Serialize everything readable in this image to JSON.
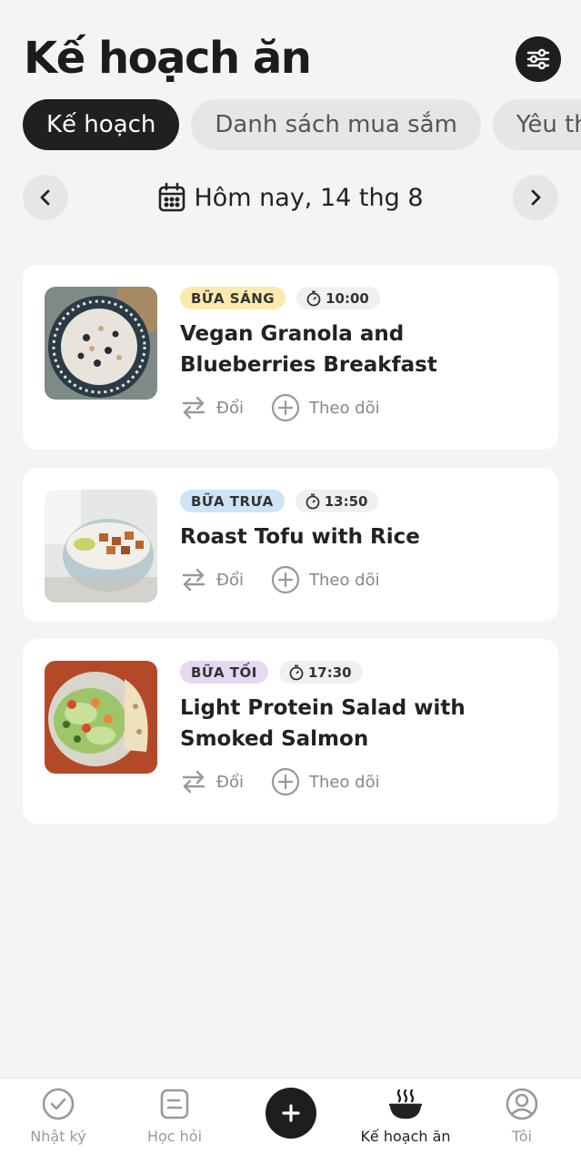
{
  "header": {
    "title": "Kế hoạch ăn",
    "settings_icon": "sliders-icon"
  },
  "tabs": [
    {
      "label": "Kế hoạch"
    },
    {
      "label": "Danh sách mua sắm"
    },
    {
      "label": "Yêu thích"
    }
  ],
  "date_nav": {
    "label": "Hôm nay, 14 thg 8"
  },
  "meals": [
    {
      "badge": "BỮA SÁNG",
      "badge_color": "#fbe9b0",
      "time": "10:00",
      "title": "Vegan Granola and Blueberries Breakfast",
      "swap": "Đổi",
      "track": "Theo dõi"
    },
    {
      "badge": "BỮA TRƯA",
      "badge_color": "#cfe3f7",
      "time": "13:50",
      "title": "Roast Tofu with Rice",
      "swap": "Đổi",
      "track": "Theo dõi"
    },
    {
      "badge": "BỮA TỐI",
      "badge_color": "#e6d8ef",
      "time": "17:30",
      "title": "Light Protein Salad with Smoked Salmon",
      "swap": "Đổi",
      "track": "Theo dõi"
    }
  ],
  "bottom_nav": [
    {
      "label": "Nhật ký",
      "icon": "check-circle-icon"
    },
    {
      "label": "Học hỏi",
      "icon": "note-icon"
    },
    {
      "label": "",
      "icon": "plus-icon"
    },
    {
      "label": "Kế hoạch ăn",
      "icon": "bowl-icon",
      "active": true
    },
    {
      "label": "Tôi",
      "icon": "user-circle-icon"
    }
  ]
}
